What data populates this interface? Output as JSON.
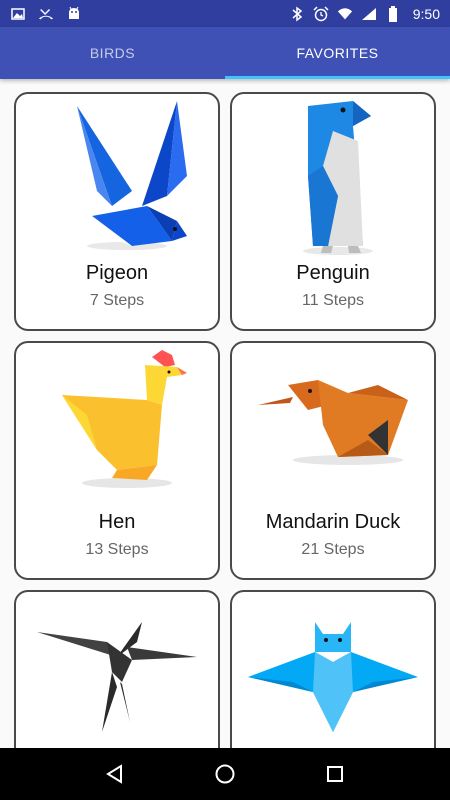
{
  "status_bar": {
    "time": "9:50",
    "left_icons": [
      "image-icon",
      "missed-call-icon",
      "android-icon"
    ],
    "right_icons": [
      "bluetooth-icon",
      "alarm-icon",
      "wifi-icon",
      "signal-icon",
      "battery-icon"
    ]
  },
  "tabs": [
    {
      "label": "BIRDS",
      "active": false
    },
    {
      "label": "FAVORITES",
      "active": true
    }
  ],
  "cards": [
    {
      "title": "Pigeon",
      "steps": "7 Steps",
      "image": "pigeon-origami"
    },
    {
      "title": "Penguin",
      "steps": "11 Steps",
      "image": "penguin-origami"
    },
    {
      "title": "Hen",
      "steps": "13 Steps",
      "image": "hen-origami"
    },
    {
      "title": "Mandarin Duck",
      "steps": "21 Steps",
      "image": "mandarin-duck-origami"
    },
    {
      "title": "",
      "steps": "",
      "image": "swallow-origami"
    },
    {
      "title": "",
      "steps": "",
      "image": "owl-origami"
    }
  ],
  "colors": {
    "status_bar": "#303f9f",
    "tab_bar": "#3f51b5",
    "tab_indicator": "#40c4ff"
  }
}
